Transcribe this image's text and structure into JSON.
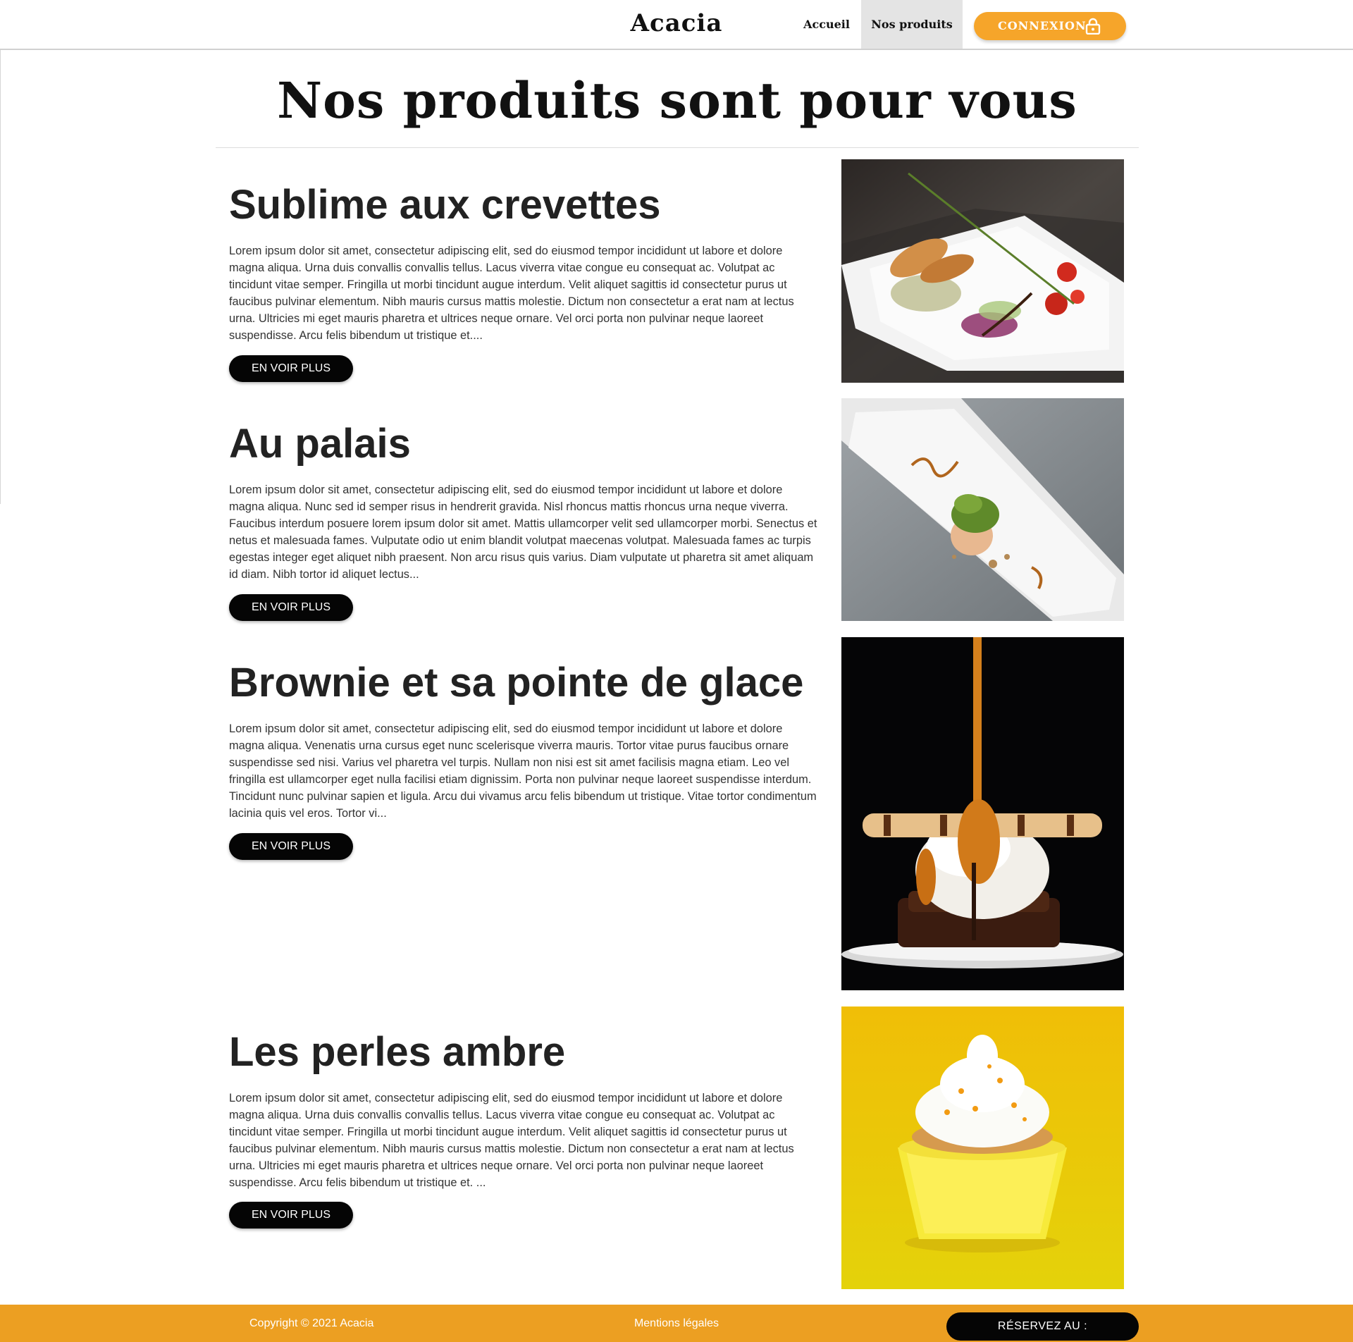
{
  "header": {
    "logo": "Acacia",
    "nav": [
      {
        "label": "Accueil",
        "active": false
      },
      {
        "label": "Nos produits",
        "active": true
      }
    ],
    "login_label": "CONNEXION",
    "login_icon": "lock-icon",
    "accent_color": "#f6a52a"
  },
  "page": {
    "title": "Nos produits sont pour vous"
  },
  "products": [
    {
      "name": "Sublime aux crevettes",
      "description": "Lorem ipsum dolor sit amet, consectetur adipiscing elit, sed do eiusmod tempor incididunt ut labore et dolore magna aliqua. Urna duis convallis convallis tellus. Lacus viverra vitae congue eu consequat ac. Volutpat ac tincidunt vitae semper. Fringilla ut morbi tincidunt augue interdum. Velit aliquet sagittis id consectetur purus ut faucibus pulvinar elementum. Nibh mauris cursus mattis molestie. Dictum non consectetur a erat nam at lectus urna. Ultricies mi eget mauris pharetra et ultrices neque ornare. Vel orci porta non pulvinar neque laoreet suspendisse. Arcu felis bibendum ut tristique et....",
      "button": "EN VOIR PLUS"
    },
    {
      "name": "Au palais",
      "description": "Lorem ipsum dolor sit amet, consectetur adipiscing elit, sed do eiusmod tempor incididunt ut labore et dolore magna aliqua. Nunc sed id semper risus in hendrerit gravida. Nisl rhoncus mattis rhoncus urna neque viverra. Faucibus interdum posuere lorem ipsum dolor sit amet. Mattis ullamcorper velit sed ullamcorper morbi. Senectus et netus et malesuada fames. Vulputate odio ut enim blandit volutpat maecenas volutpat. Malesuada fames ac turpis egestas integer eget aliquet nibh praesent. Non arcu risus quis varius. Diam vulputate ut pharetra sit amet aliquam id diam. Nibh tortor id aliquet lectus...",
      "button": "EN VOIR PLUS"
    },
    {
      "name": "Brownie et sa pointe de glace",
      "description": "Lorem ipsum dolor sit amet, consectetur adipiscing elit, sed do eiusmod tempor incididunt ut labore et dolore magna aliqua. Venenatis urna cursus eget nunc scelerisque viverra mauris. Tortor vitae purus faucibus ornare suspendisse sed nisi. Varius vel pharetra vel turpis. Nullam non nisi est sit amet facilisis magna etiam. Leo vel fringilla est ullamcorper eget nulla facilisi etiam dignissim. Porta non pulvinar neque laoreet suspendisse interdum. Tincidunt nunc pulvinar sapien et ligula. Arcu dui vivamus arcu felis bibendum ut tristique. Vitae tortor condimentum lacinia quis vel eros. Tortor vi...",
      "button": "EN VOIR PLUS"
    },
    {
      "name": "Les perles ambre",
      "description": "Lorem ipsum dolor sit amet, consectetur adipiscing elit, sed do eiusmod tempor incididunt ut labore et dolore magna aliqua. Urna duis convallis convallis tellus. Lacus viverra vitae congue eu consequat ac. Volutpat ac tincidunt vitae semper. Fringilla ut morbi tincidunt augue interdum. Velit aliquet sagittis id consectetur purus ut faucibus pulvinar elementum. Nibh mauris cursus mattis molestie. Dictum non consectetur a erat nam at lectus urna. Ultricies mi eget mauris pharetra et ultrices neque ornare. Vel orci porta non pulvinar neque laoreet suspendisse. Arcu felis bibendum ut tristique et. ...",
      "button": "EN VOIR PLUS"
    }
  ],
  "footer": {
    "copyright": "Copyright © 2021 Acacia",
    "legal": "Mentions légales",
    "reserve": "RÉSERVEZ AU :",
    "color": "#ec9f22"
  }
}
